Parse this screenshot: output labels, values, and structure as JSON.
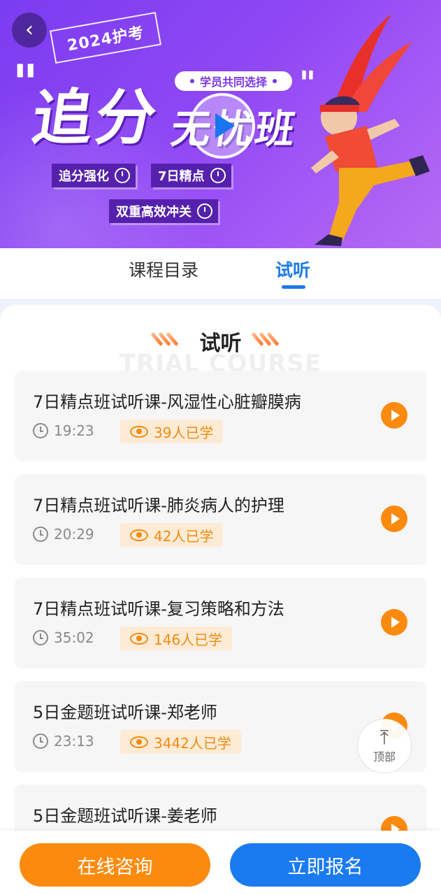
{
  "banner": {
    "year_tag": "2024护考",
    "title_main": "追分",
    "title_second": "无忧班",
    "pill": "学员共同选择",
    "tags": [
      "追分强化",
      "7日精点",
      "双重高效冲关"
    ]
  },
  "tabs": [
    {
      "label": "课程目录",
      "active": false
    },
    {
      "label": "试听",
      "active": true
    }
  ],
  "section": {
    "title": "试听",
    "bg_text": "TRIAL COURSE"
  },
  "items": [
    {
      "title": "7日精点班试听课-风湿性心脏瓣膜病",
      "duration": "19:23",
      "views": "39人已学"
    },
    {
      "title": "7日精点班试听课-肺炎病人的护理",
      "duration": "20:29",
      "views": "42人已学"
    },
    {
      "title": "7日精点班试听课-复习策略和方法",
      "duration": "35:02",
      "views": "146人已学"
    },
    {
      "title": "5日金题班试听课-郑老师",
      "duration": "23:13",
      "views": "3442人已学"
    },
    {
      "title": "5日金题班试听课-姜老师",
      "duration": "",
      "views": ""
    }
  ],
  "back_to_top": {
    "label": "顶部"
  },
  "bottom": {
    "consult": "在线咨询",
    "signup": "立即报名"
  },
  "colors": {
    "accent_blue": "#1a7af0",
    "accent_orange": "#fb8b0f",
    "banner_purple": "#8f47f4"
  }
}
